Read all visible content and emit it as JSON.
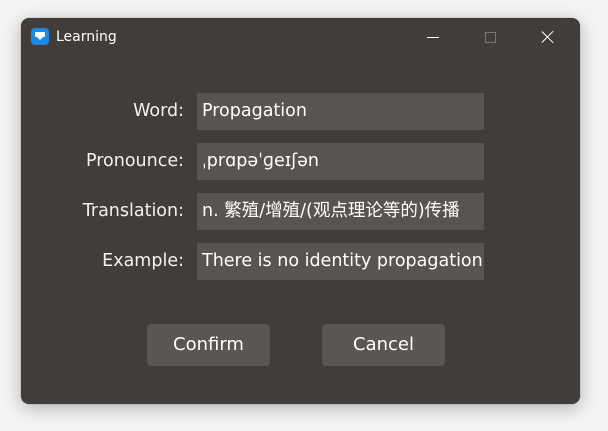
{
  "window": {
    "title": "Learning",
    "accent_color": "#1e88e5",
    "background_color": "#403d3a"
  },
  "titlebar": {
    "app_icon": "message-bubble-icon",
    "minimize_icon": "minimize-icon",
    "maximize_icon": "maximize-icon",
    "close_icon": "close-icon"
  },
  "form": {
    "rows": [
      {
        "label": "Word:",
        "value": "Propagation"
      },
      {
        "label": "Pronounce:",
        "value": "ˌprɑpəˈɡeɪʃən"
      },
      {
        "label": "Translation:",
        "value": "n. 繁殖/增殖/(观点理论等的)传播"
      },
      {
        "label": "Example:",
        "value": "There is no identity propagation"
      }
    ]
  },
  "buttons": {
    "confirm_label": "Confirm",
    "cancel_label": "Cancel"
  }
}
